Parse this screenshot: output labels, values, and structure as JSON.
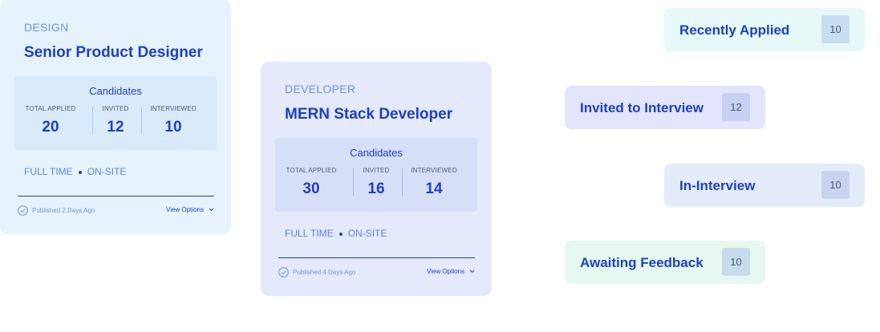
{
  "jobs": [
    {
      "category": "DESIGN",
      "title": "Senior Product Designer",
      "candidates_title": "Candidates",
      "stats": [
        {
          "label": "TOTAL APPLIED",
          "value": "20"
        },
        {
          "label": "INVITED",
          "value": "12"
        },
        {
          "label": "INTERVIEWED",
          "value": "10"
        }
      ],
      "employment_type": "FULL TIME",
      "location_type": "ON-SITE",
      "published": "Published 2 Days Ago",
      "view_options": "View Options"
    },
    {
      "category": "DEVELOPER",
      "title": "MERN Stack Developer",
      "candidates_title": "Candidates",
      "stats": [
        {
          "label": "TOTAL APPLIED",
          "value": "30"
        },
        {
          "label": "INVITED",
          "value": "16"
        },
        {
          "label": "INTERVIEWED",
          "value": "14"
        }
      ],
      "employment_type": "FULL TIME",
      "location_type": "ON-SITE",
      "published": "Published 4 Days Ago",
      "view_options": "View Options"
    }
  ],
  "pipeline": [
    {
      "label": "Recently Applied",
      "count": "10"
    },
    {
      "label": "Invited to Interview",
      "count": "12"
    },
    {
      "label": "In-Interview",
      "count": "10"
    },
    {
      "label": "Awaiting Feedback",
      "count": "10"
    }
  ],
  "icons": {
    "published": "check-circle-icon",
    "view_options": "chevron-down-icon"
  },
  "colors": {
    "accent": "#1d3fc4",
    "muted": "#6f96d6",
    "card_design_bg": "#e6f3fd",
    "card_developer_bg": "#e4e9fb"
  }
}
